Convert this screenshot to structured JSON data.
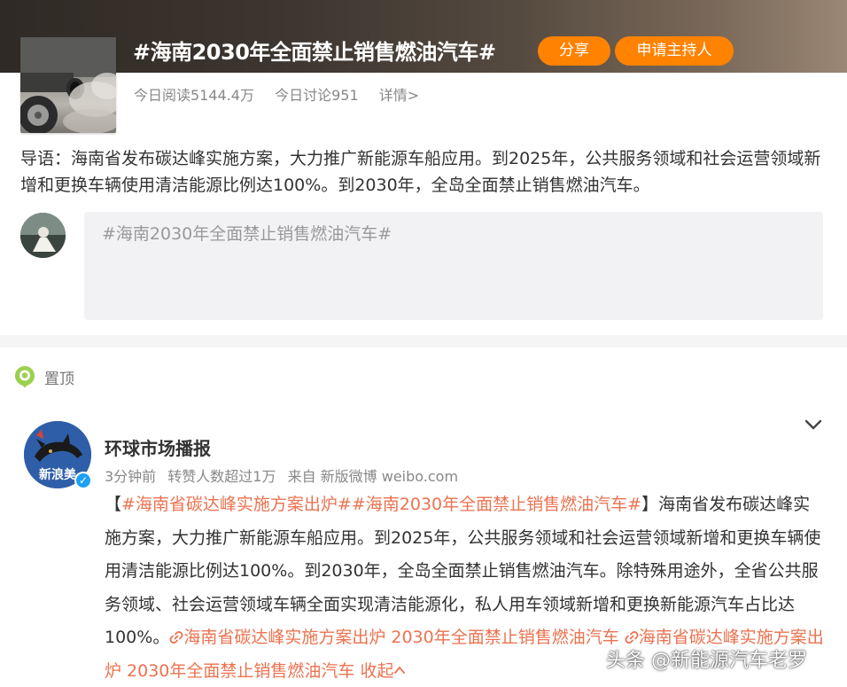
{
  "topic": {
    "title": "#海南2030年全面禁止销售燃油汽车#",
    "share_label": "分享",
    "apply_host_label": "申请主持人",
    "reads": "今日阅读5144.4万",
    "discussions": "今日讨论951",
    "details_label": "详情>"
  },
  "intro": "导语：海南省发布碳达峰实施方案，大力推广新能源车船应用。到2025年，公共服务领域和社会运营领域新增和更换车辆使用清洁能源比例达100%。到2030年，全岛全面禁止销售燃油汽车。",
  "compose": {
    "text": "#海南2030年全面禁止销售燃油汽车#"
  },
  "pinned": {
    "label": "置顶"
  },
  "post": {
    "author": "环球市场播报",
    "avatar_text": "新浪美",
    "time": "3分钟前",
    "reposts": "转赞人数超过1万",
    "source": "来自 新版微博 weibo.com",
    "text": {
      "bracket_open": "【",
      "tag1": "#海南省碳达峰实施方案出炉#",
      "tag2": "#海南2030年全面禁止销售燃油汽车#",
      "bracket_close": "】",
      "body": "海南省发布碳达峰实施方案，大力推广新能源车船应用。到2025年，公共服务领域和社会运营领域新增和更换车辆使用清洁能源比例达100%。到2030年，全岛全面禁止销售燃油汽车。除特殊用途外，全省公共服务领域、社会运营领域车辆全面实现清洁能源化，私人用车领域新增和更换新能源汽车占比达100%。",
      "link1": "海南省碳达峰实施方案出炉 2030年全面禁止销售燃油汽车",
      "link2": "海南省碳达峰实施方案出炉 2030年全面禁止销售燃油汽车",
      "collapse": "收起"
    }
  },
  "watermark": "头条 @新能源汽车老罗",
  "colors": {
    "accent_orange": "#ff8200",
    "tag_color": "#eb7350"
  }
}
